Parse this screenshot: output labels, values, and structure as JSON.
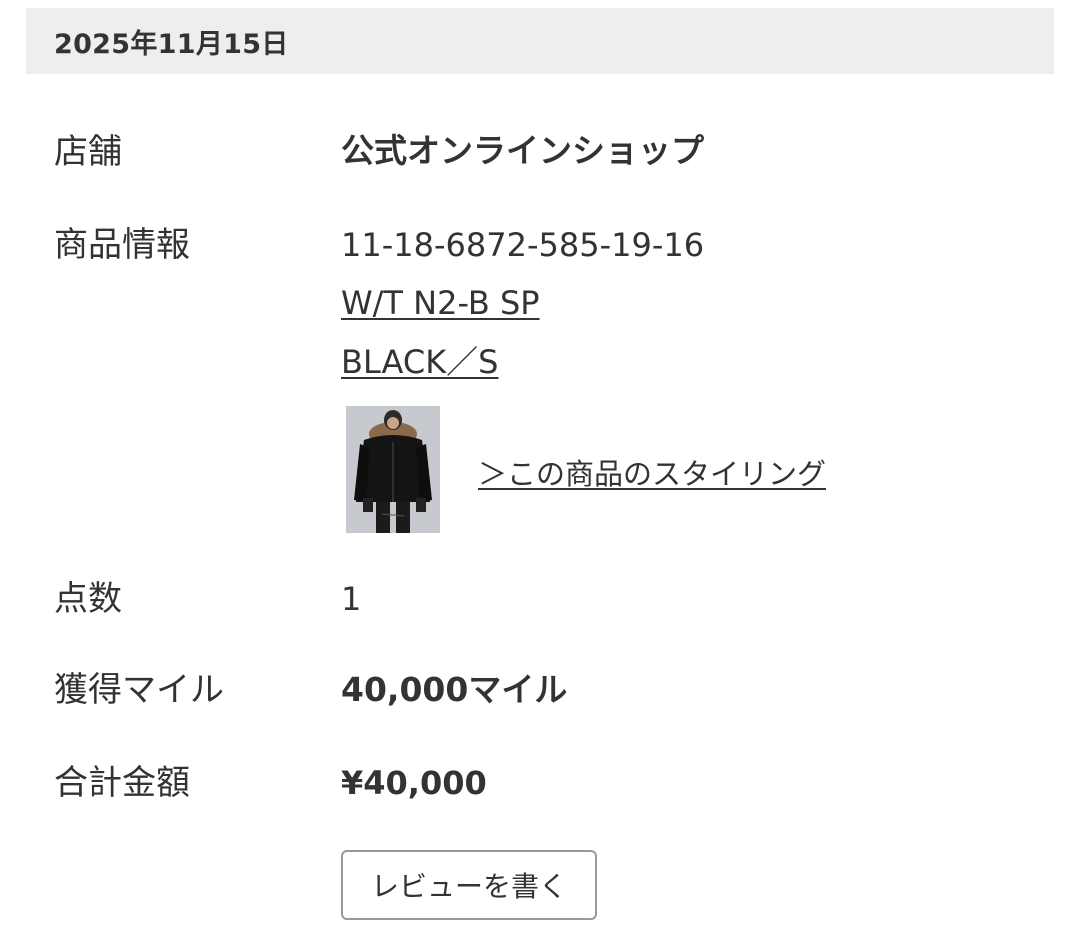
{
  "order": {
    "date": "2025年11月15日"
  },
  "fields": {
    "store": {
      "label": "店舗",
      "value": "公式オンラインショップ"
    },
    "product": {
      "label": "商品情報",
      "code": "11-18-6872-585-19-16",
      "name": "W/T N2-B SP",
      "variant": "BLACK／S",
      "image_alt": "product-photo",
      "styling_link": "＞この商品のスタイリング"
    },
    "quantity": {
      "label": "点数",
      "value": "1"
    },
    "miles": {
      "label": "獲得マイル",
      "value": "40,000マイル"
    },
    "total": {
      "label": "合計金額",
      "value": "¥40,000"
    }
  },
  "actions": {
    "review_button": "レビューを書く"
  }
}
